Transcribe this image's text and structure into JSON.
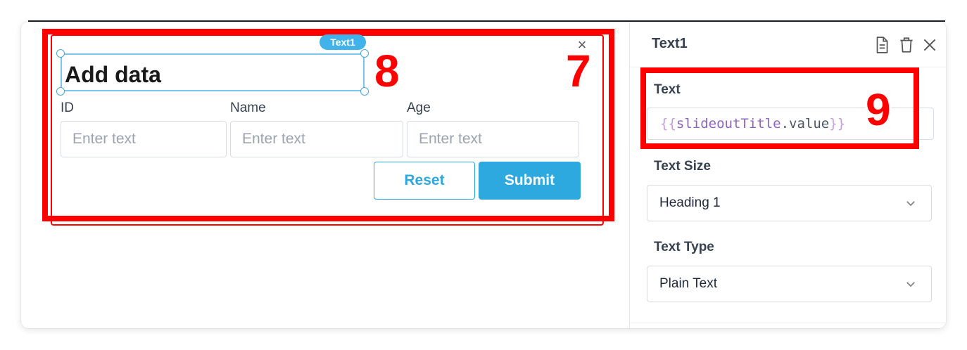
{
  "form": {
    "component_tag": "Text1",
    "title": "Add data",
    "close_glyph": "×",
    "fields": [
      {
        "label": "ID",
        "placeholder": "Enter text"
      },
      {
        "label": "Name",
        "placeholder": "Enter text"
      },
      {
        "label": "Age",
        "placeholder": "Enter text"
      }
    ],
    "reset_label": "Reset",
    "submit_label": "Submit"
  },
  "annotations": {
    "form_marker": "7",
    "title_marker": "8",
    "text_marker": "9"
  },
  "inspector": {
    "title": "Text1",
    "icons": [
      "document-icon",
      "trash-icon",
      "close-icon"
    ],
    "text_label": "Text",
    "text_value": {
      "open": "{{",
      "identifier": "slideoutTitle",
      "property": ".value",
      "close": "}}"
    },
    "size_label": "Text Size",
    "size_value": "Heading 1",
    "type_label": "Text Type",
    "type_value": "Plain Text"
  },
  "colors": {
    "annotation": "#ff0000",
    "accent": "#2ea9e0",
    "selection": "#7cc6ee"
  }
}
